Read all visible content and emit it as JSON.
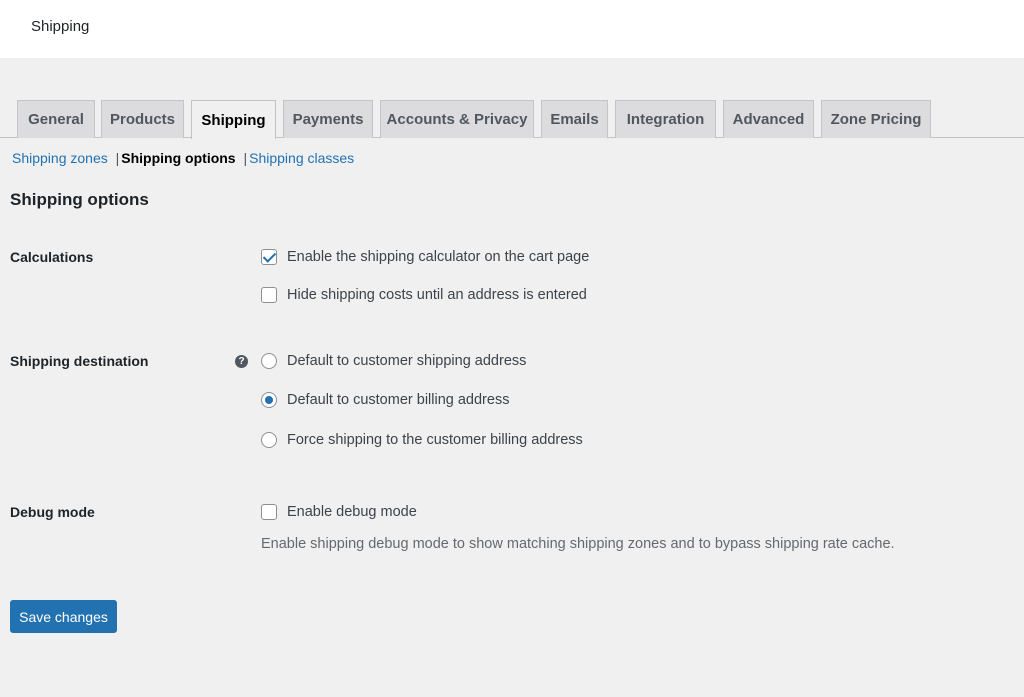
{
  "header": {
    "title": "Shipping"
  },
  "tabs": [
    {
      "label": "General",
      "active": false
    },
    {
      "label": "Products",
      "active": false
    },
    {
      "label": "Shipping",
      "active": true
    },
    {
      "label": "Payments",
      "active": false
    },
    {
      "label": "Accounts & Privacy",
      "active": false
    },
    {
      "label": "Emails",
      "active": false
    },
    {
      "label": "Integration",
      "active": false
    },
    {
      "label": "Advanced",
      "active": false
    },
    {
      "label": "Zone Pricing",
      "active": false
    }
  ],
  "subnav": {
    "items": [
      {
        "label": "Shipping zones",
        "current": false
      },
      {
        "label": "Shipping options",
        "current": true
      },
      {
        "label": "Shipping classes",
        "current": false
      }
    ],
    "separator": "|"
  },
  "section_title": "Shipping options",
  "calculations": {
    "label": "Calculations",
    "options": [
      {
        "label": "Enable the shipping calculator on the cart page",
        "checked": true
      },
      {
        "label": "Hide shipping costs until an address is entered",
        "checked": false
      }
    ]
  },
  "destination": {
    "label": "Shipping destination",
    "help_icon": "question-mark-icon",
    "help_glyph": "?",
    "options": [
      {
        "label": "Default to customer shipping address",
        "selected": false
      },
      {
        "label": "Default to customer billing address",
        "selected": true
      },
      {
        "label": "Force shipping to the customer billing address",
        "selected": false
      }
    ]
  },
  "debug": {
    "label": "Debug mode",
    "option": {
      "label": "Enable debug mode",
      "checked": false
    },
    "description": "Enable shipping debug mode to show matching shipping zones and to bypass shipping rate cache."
  },
  "save_button": {
    "label": "Save changes"
  },
  "colors": {
    "accent": "#2271b1",
    "background": "#f0f0f1",
    "text": "#1d2327"
  }
}
